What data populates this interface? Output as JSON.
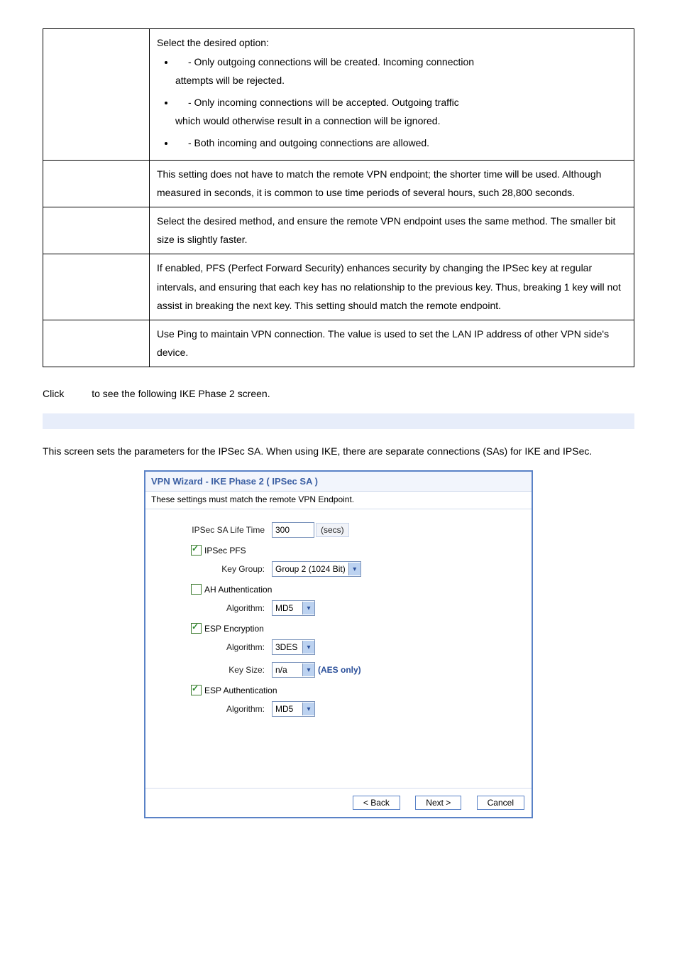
{
  "table": {
    "row1": {
      "lead": "Select the desired option:",
      "bullet1": " - Only outgoing connections will be created. Incoming connection",
      "bullet1b": "attempts will be rejected.",
      "bullet2": " - Only incoming connections will be accepted. Outgoing traffic",
      "bullet2b": "which would otherwise result in a connection will be ignored.",
      "bullet3": " - Both incoming and outgoing connections are allowed."
    },
    "row2": "This setting does not have to match the remote VPN endpoint; the shorter time will be used. Although measured in seconds, it is common to use time periods of several hours, such 28,800 seconds.",
    "row3": "Select the desired method, and ensure the remote VPN endpoint uses the same method. The smaller bit size is slightly faster.",
    "row4": "If enabled, PFS (Perfect Forward Security) enhances security by changing the IPSec key at regular intervals, and ensuring that each key has no relationship to the previous key. Thus, breaking 1 key will not assist in breaking the next key. This setting should match the remote endpoint.",
    "row5": "Use Ping to maintain VPN connection. The value is used to set the LAN IP address of other VPN side's device."
  },
  "click_line": "Click          to see the following IKE Phase 2 screen.",
  "screen_desc": "This screen sets the parameters for the IPSec SA. When using IKE, there are separate connections (SAs) for IKE and IPSec.",
  "wizard": {
    "title": "VPN Wizard - IKE Phase 2 ( IPSec SA )",
    "subtitle": "These settings must match the remote VPN Endpoint.",
    "ipsec_life_label": "IPSec SA Life Time",
    "ipsec_life_value": "300",
    "secs": "(secs)",
    "ipsec_pfs": "IPSec PFS",
    "key_group_label": "Key Group:",
    "key_group_value": "Group 2 (1024 Bit)",
    "ah_auth": "AH Authentication",
    "algo_label": "Algorithm:",
    "ah_algo_value": "MD5",
    "esp_enc": "ESP Encryption",
    "esp_algo_value": "3DES",
    "key_size_label": "Key Size:",
    "key_size_value": "n/a",
    "aes_only": "(AES only)",
    "esp_auth": "ESP Authentication",
    "esp_auth_algo_value": "MD5",
    "btn_back": "< Back",
    "btn_next": "Next >",
    "btn_cancel": "Cancel"
  }
}
